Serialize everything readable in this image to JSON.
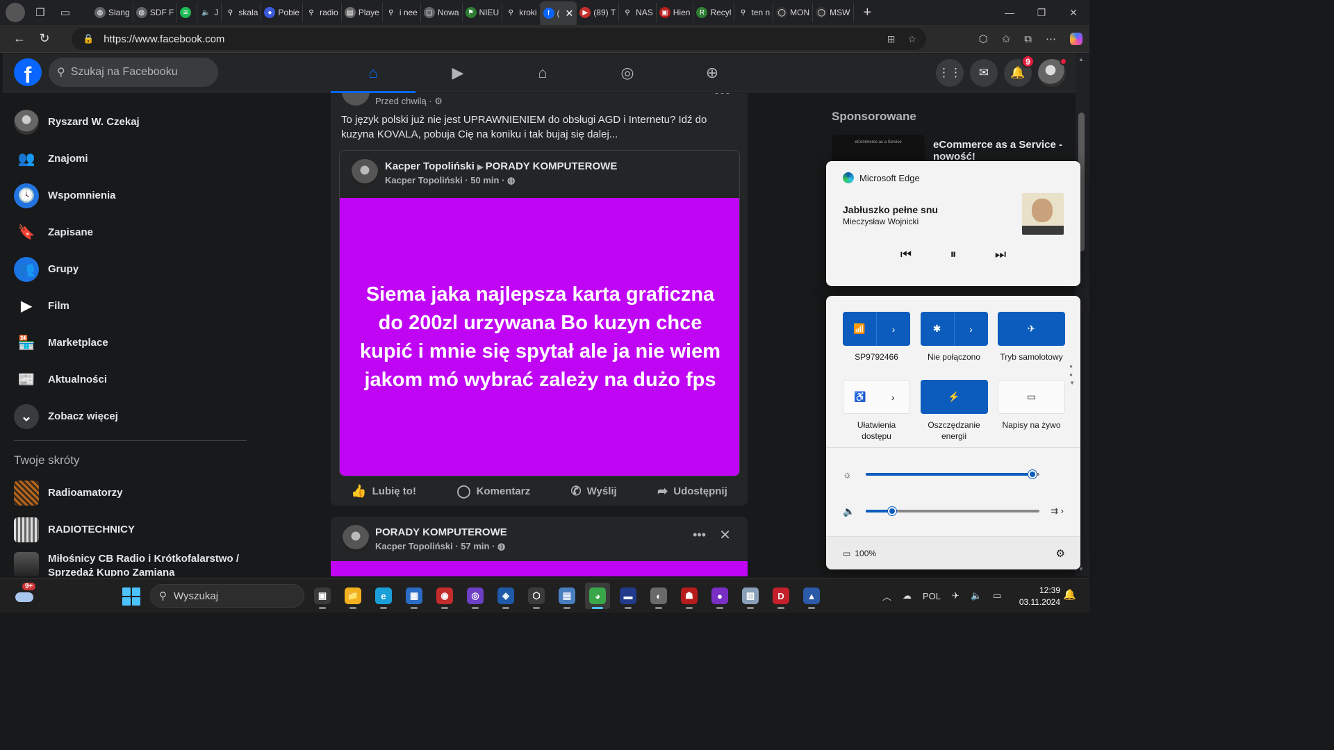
{
  "browser": {
    "tabs": [
      {
        "label": "Slang",
        "color": "#5f6368",
        "glyph": "◍"
      },
      {
        "label": "SDF F",
        "color": "#5f6368",
        "glyph": "◍"
      },
      {
        "label": "",
        "color": "#1db954",
        "glyph": "≋"
      },
      {
        "label": "J",
        "color": "#202124",
        "glyph": "🔈"
      },
      {
        "label": "skala",
        "color": "#202124",
        "glyph": "⚲"
      },
      {
        "label": "Pobie",
        "color": "#3b5bdb",
        "glyph": "●"
      },
      {
        "label": "radio",
        "color": "#202124",
        "glyph": "⚲"
      },
      {
        "label": "Playe",
        "color": "#6b6b6b",
        "glyph": "▤"
      },
      {
        "label": "i nee",
        "color": "#202124",
        "glyph": "⚲"
      },
      {
        "label": "Nowa",
        "color": "#5f6368",
        "glyph": "▢"
      },
      {
        "label": "NIEU",
        "color": "#2e7d32",
        "glyph": "⚑"
      },
      {
        "label": "kroki",
        "color": "#202124",
        "glyph": "⚲"
      },
      {
        "label": "(",
        "color": "#0866ff",
        "glyph": "f",
        "active": true
      },
      {
        "label": "(89) T",
        "color": "#c4302b",
        "glyph": "▶"
      },
      {
        "label": "NAS",
        "color": "#202124",
        "glyph": "⚲"
      },
      {
        "label": "Hien",
        "color": "#b71c1c",
        "glyph": "▣"
      },
      {
        "label": "Recyl",
        "color": "#2e7d32",
        "glyph": "R"
      },
      {
        "label": "ten n",
        "color": "#202124",
        "glyph": "⚲"
      },
      {
        "label": "MON",
        "color": "#333333",
        "glyph": "◯"
      },
      {
        "label": "MSW",
        "color": "#333333",
        "glyph": "◯"
      }
    ],
    "url_host": "https://www.facebook.com",
    "new_tab_symbol": "+"
  },
  "fb": {
    "search_placeholder": "Szukaj na Facebooku",
    "notifications_count": "9",
    "sidebar": [
      {
        "label": "Ryszard W. Czekaj",
        "icon": "profile-avatar",
        "bg": "#555555",
        "glyph": ""
      },
      {
        "label": "Znajomi",
        "icon": "friends-icon",
        "bg": "transparent",
        "glyph": "👥"
      },
      {
        "label": "Wspomnienia",
        "icon": "memories-icon",
        "bg": "#2374e1",
        "glyph": "🕓"
      },
      {
        "label": "Zapisane",
        "icon": "saved-icon",
        "bg": "transparent",
        "glyph": "🔖"
      },
      {
        "label": "Grupy",
        "icon": "groups-icon",
        "bg": "#1b74e4",
        "glyph": "👥"
      },
      {
        "label": "Film",
        "icon": "video-icon",
        "bg": "transparent",
        "glyph": "▶"
      },
      {
        "label": "Marketplace",
        "icon": "marketplace-icon",
        "bg": "transparent",
        "glyph": "🏪"
      },
      {
        "label": "Aktualności",
        "icon": "feeds-icon",
        "bg": "transparent",
        "glyph": "📰"
      },
      {
        "label": "Zobacz więcej",
        "icon": "chevron-down-icon",
        "bg": "#3a3b3c",
        "glyph": "⌄"
      }
    ],
    "shortcuts_title": "Twoje skróty",
    "shortcuts": [
      {
        "label": "Radioamatorzy"
      },
      {
        "label": "RADIOTECHNICY"
      },
      {
        "label": "Miłośnicy CB Radio i Krótkofalarstwo / Sprzedaż Kupno Zamiana"
      }
    ],
    "post": {
      "time": "Przed chwilą ·",
      "text": "To język polski już nie jest UPRAWNIENIEM do obsługi AGD i Internetu? Idź do kuzyna KOVALA, pobuja Cię na koniku i tak bujaj się dalej...",
      "shared_author": "Kacper Topoliński",
      "shared_group": "PORADY KOMPUTEROWE",
      "shared_sub": "Kacper Topoliński · 50 min ·",
      "shared_body": "Siema jaka najlepsza karta graficzna do 200zl urzywana Bo kuzyn chce kupić i mnie się spytał ale ja nie wiem jakom mó wybrać zależy na dużo fps",
      "actions": [
        "Lubię to!",
        "Komentarz",
        "Wyślij",
        "Udostępnij"
      ]
    },
    "post2": {
      "title": "PORADY KOMPUTEROWE",
      "sub": "Kacper Topoliński · 57 min ·"
    },
    "sponsored_title": "Sponsorowane",
    "ad_title": "eCommerce as a Service - nowość!",
    "ad_thumb_text": "eCommerce as a Service"
  },
  "media": {
    "app": "Microsoft Edge",
    "title": "Jabłuszko pełne snu",
    "artist": "Mieczysław Wojnicki"
  },
  "quick_settings": {
    "tiles_row1": [
      {
        "label": "SP9792466",
        "on": true,
        "glyph": "📶",
        "split": true
      },
      {
        "label": "Nie połączono",
        "on": true,
        "glyph": "✱",
        "split": true
      },
      {
        "label": "Tryb samolotowy",
        "on": true,
        "glyph": "✈",
        "split": false
      }
    ],
    "tiles_row2": [
      {
        "label": "Ułatwienia dostępu",
        "on": false,
        "glyph": "♿",
        "split": true
      },
      {
        "label": "Oszczędzanie energii",
        "on": true,
        "glyph": "⚡",
        "split": false
      },
      {
        "label": "Napisy na żywo",
        "on": false,
        "glyph": "▭",
        "split": false
      }
    ],
    "brightness": 0.96,
    "volume": 0.15,
    "battery": "100%"
  },
  "taskbar": {
    "weather_badge": "9+",
    "search_placeholder": "Wyszukaj",
    "apps": [
      {
        "name": "task-view",
        "color": "#3a3a3a",
        "glyph": "▣"
      },
      {
        "name": "file-explorer",
        "color": "#f2b01e",
        "glyph": "📁"
      },
      {
        "name": "edge",
        "color": "#1a9fd8",
        "glyph": "e"
      },
      {
        "name": "store",
        "color": "#2b6cc4",
        "glyph": "▦"
      },
      {
        "name": "app-red",
        "color": "#c42b2b",
        "glyph": "◉"
      },
      {
        "name": "app-purple",
        "color": "#6d3fc4",
        "glyph": "◎"
      },
      {
        "name": "app-blue",
        "color": "#1e5aa8",
        "glyph": "◈"
      },
      {
        "name": "app-cube",
        "color": "#3b3b3b",
        "glyph": "⬡"
      },
      {
        "name": "app-monitor",
        "color": "#4a7fbf",
        "glyph": "▤"
      },
      {
        "name": "app-globe",
        "color": "#3aa64a",
        "glyph": "◕",
        "active": true
      },
      {
        "name": "app-save",
        "color": "#223a8a",
        "glyph": "▬"
      },
      {
        "name": "app-disk",
        "color": "#6a6a6a",
        "glyph": "◐"
      },
      {
        "name": "app-hat",
        "color": "#b71c1c",
        "glyph": "☗"
      },
      {
        "name": "app-orb",
        "color": "#7a2fc4",
        "glyph": "●"
      },
      {
        "name": "app-tool",
        "color": "#8aa0b8",
        "glyph": "▥"
      },
      {
        "name": "app-d",
        "color": "#c4202b",
        "glyph": "D"
      },
      {
        "name": "app-triangle",
        "color": "#2a5aa8",
        "glyph": "▲"
      }
    ],
    "language": "POL",
    "time": "12:39",
    "date": "03.11.2024"
  }
}
